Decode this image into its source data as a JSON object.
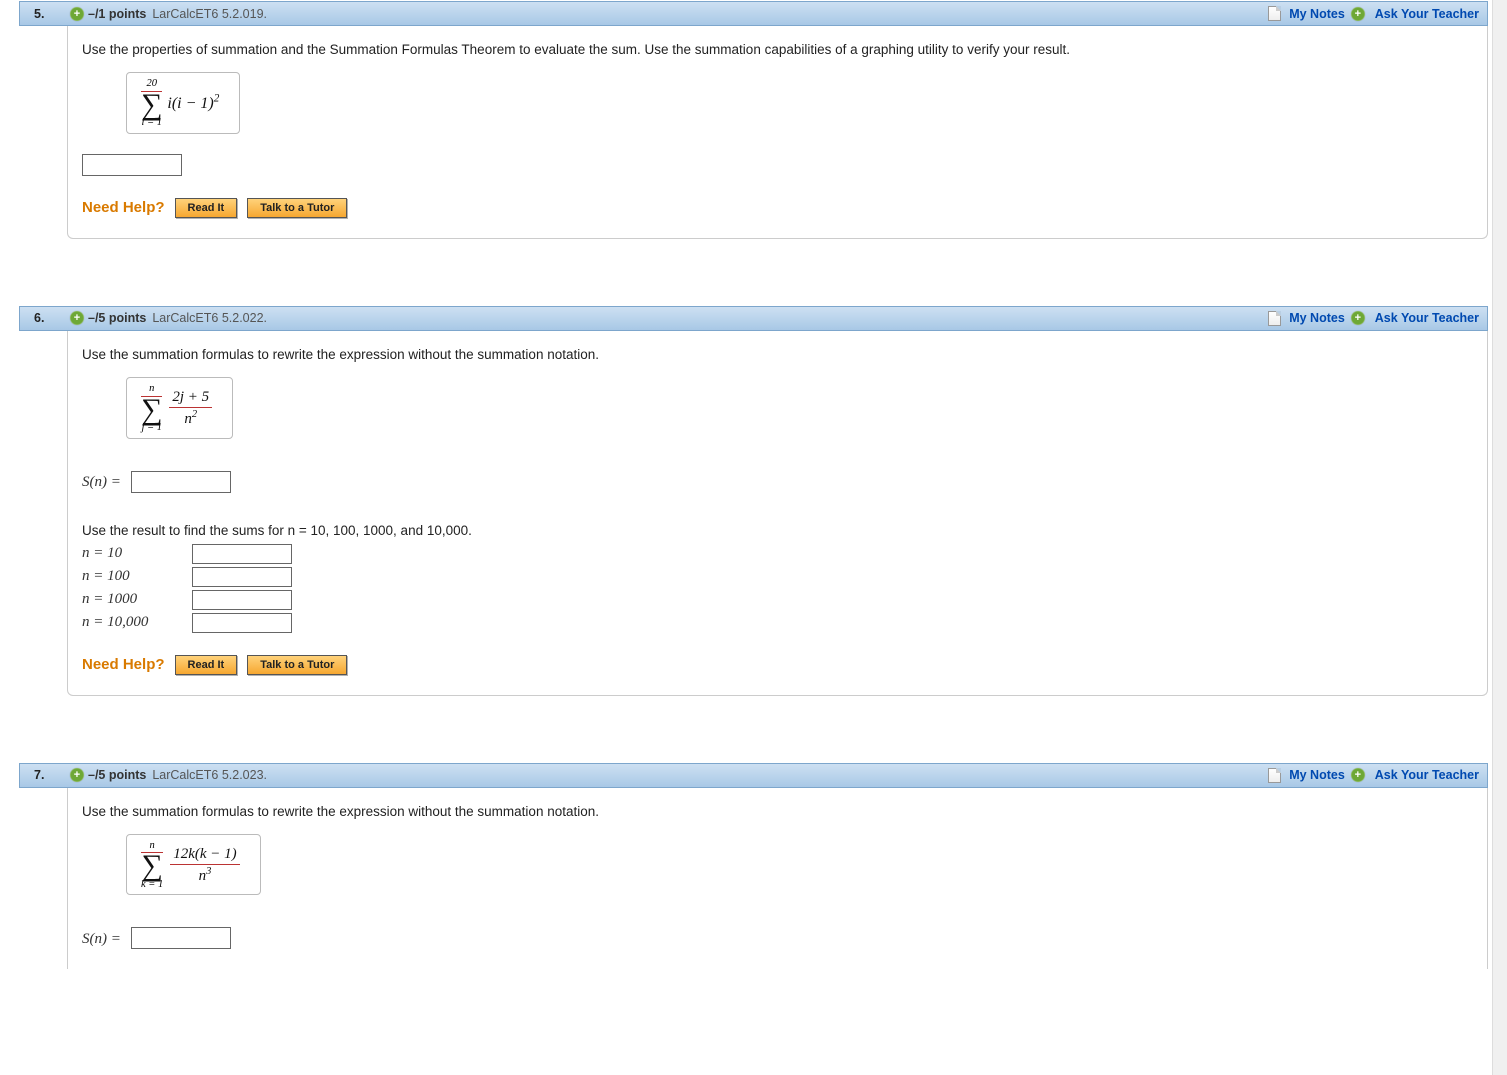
{
  "common": {
    "my_notes": "My Notes",
    "ask_teacher": "Ask Your Teacher",
    "need_help": "Need Help?",
    "read_it": "Read It",
    "talk_tutor": "Talk to a Tutor"
  },
  "q5": {
    "num": "5.",
    "points": "–/1 points",
    "source": "LarCalcET6 5.2.019.",
    "prompt": "Use the properties of summation and the Summation Formulas Theorem to evaluate the sum. Use the summation capabilities of a graphing utility to verify your result.",
    "sum_upper": "20",
    "sum_lower": "i = 1",
    "sum_body_html": "i(i − 1)<sup>2</sup>"
  },
  "q6": {
    "num": "6.",
    "points": "–/5 points",
    "source": "LarCalcET6 5.2.022.",
    "prompt": "Use the summation formulas to rewrite the expression without the summation notation.",
    "sum_upper": "n",
    "sum_lower": "j = 1",
    "frac_num": "2j + 5",
    "frac_den_html": "n<sup>2</sup>",
    "sn_label": "S(n) =",
    "sub_prompt": "Use the result to find the sums for n = 10, 100, 1000, and 10,000.",
    "rows": [
      {
        "label": "n = 10"
      },
      {
        "label": "n = 100"
      },
      {
        "label": "n = 1000"
      },
      {
        "label": "n = 10,000"
      }
    ]
  },
  "q7": {
    "num": "7.",
    "points": "–/5 points",
    "source": "LarCalcET6 5.2.023.",
    "prompt": "Use the summation formulas to rewrite the expression without the summation notation.",
    "sum_upper": "n",
    "sum_lower": "k = 1",
    "frac_num": "12k(k − 1)",
    "frac_den_html": "n<sup>3</sup>",
    "sn_label": "S(n)  ="
  }
}
